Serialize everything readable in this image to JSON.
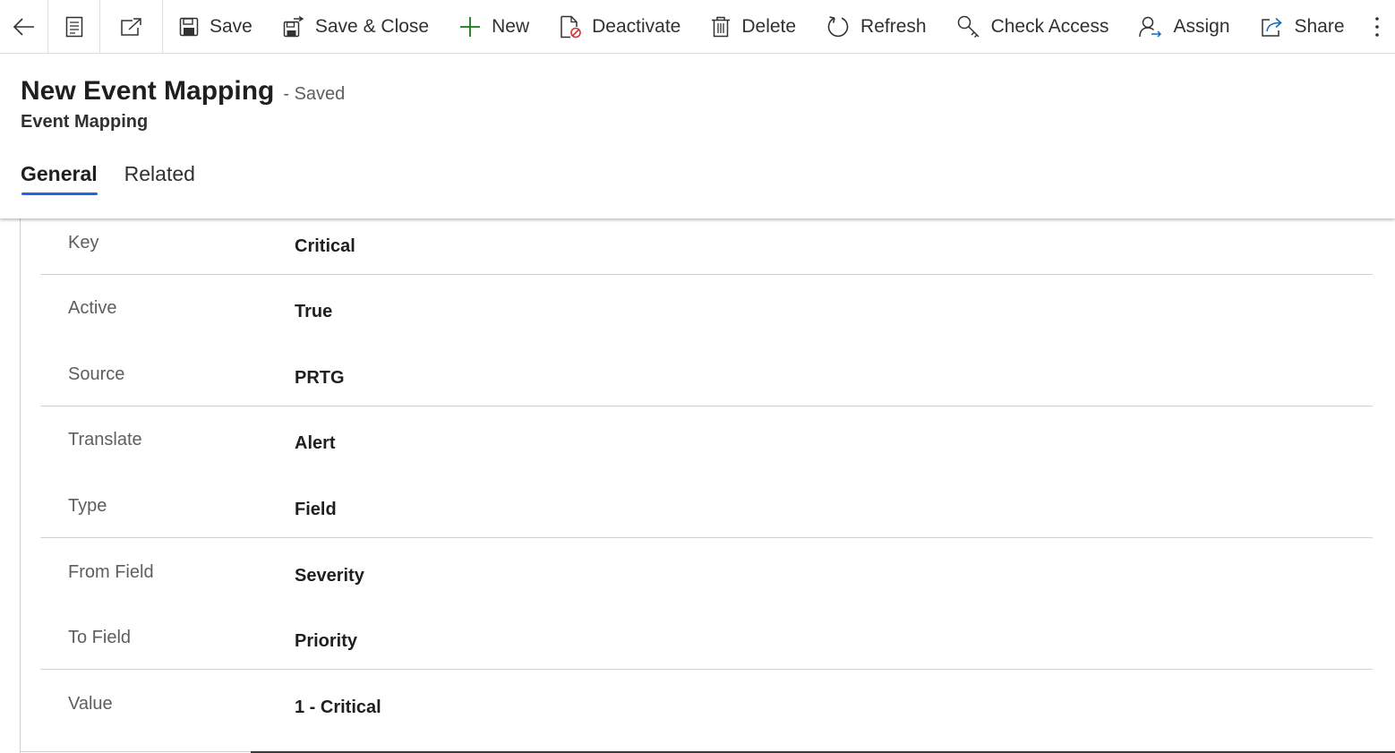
{
  "toolbar": {
    "save": "Save",
    "save_close": "Save & Close",
    "new": "New",
    "deactivate": "Deactivate",
    "delete": "Delete",
    "refresh": "Refresh",
    "check_access": "Check Access",
    "assign": "Assign",
    "share": "Share",
    "icons": [
      "back-arrow-icon",
      "form-icon",
      "open-new-window-icon",
      "save-icon",
      "save-close-icon",
      "plus-icon",
      "deactivate-icon",
      "trash-icon",
      "refresh-icon",
      "check-access-icon",
      "assign-icon",
      "share-icon",
      "more-options-icon"
    ],
    "new_icon_color": "#107c10",
    "deactivate_badge_color": "#d13438"
  },
  "header": {
    "title": "New Event Mapping",
    "status": "- Saved",
    "entity": "Event Mapping"
  },
  "tabs": [
    {
      "label": "General",
      "active": true
    },
    {
      "label": "Related",
      "active": false
    }
  ],
  "fields": [
    {
      "label": "Key",
      "value": "Critical"
    },
    {
      "label": "Active",
      "value": "True"
    },
    {
      "label": "Source",
      "value": "PRTG"
    },
    {
      "label": "Translate",
      "value": "Alert"
    },
    {
      "label": "Type",
      "value": "Field"
    },
    {
      "label": "From Field",
      "value": "Severity"
    },
    {
      "label": "To Field",
      "value": "Priority"
    },
    {
      "label": "Value",
      "value": "1 - Critical"
    }
  ],
  "colors": {
    "accent": "#2266e3",
    "text": "#323130",
    "label": "#605e5c"
  }
}
